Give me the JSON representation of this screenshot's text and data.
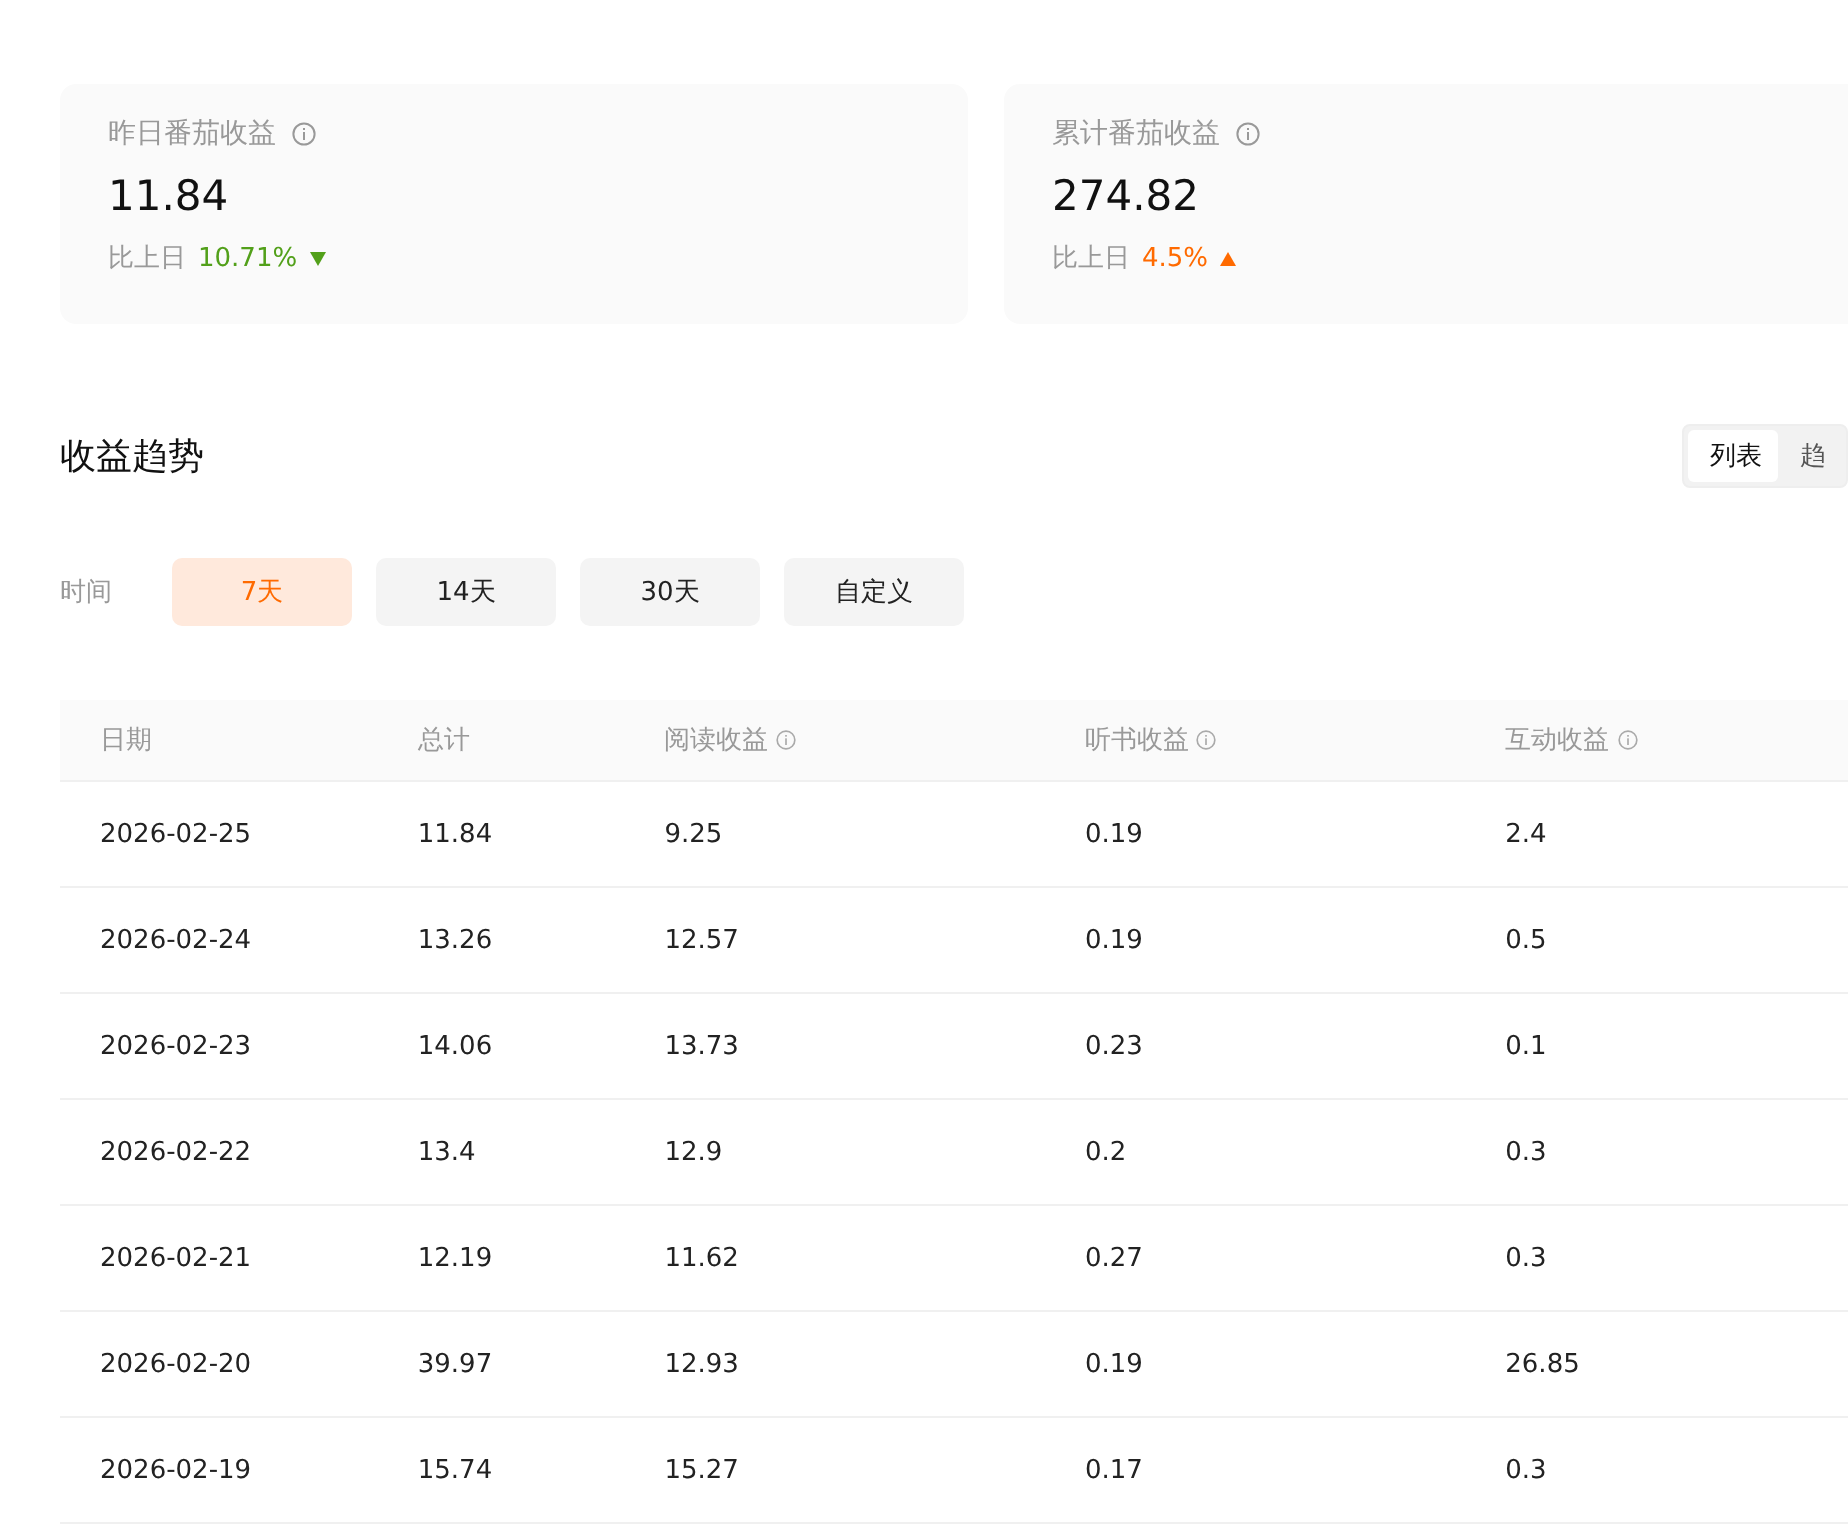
{
  "stat_cards": [
    {
      "label": "昨日番茄收益",
      "value": "11.84",
      "compare_label": "比上日",
      "change": "10.71%",
      "kind": "down"
    },
    {
      "label": "累计番茄收益",
      "value": "274.82",
      "compare_label": "比上日",
      "change": "4.5%",
      "kind": "up"
    }
  ],
  "section": {
    "title": "收益趋势",
    "view_toggle": [
      {
        "label": "列表",
        "selected": true
      },
      {
        "label": "趋",
        "selected": false
      }
    ]
  },
  "time_filter": {
    "label": "时间",
    "options": [
      {
        "label": "7天",
        "selected": true
      },
      {
        "label": "14天",
        "selected": false
      },
      {
        "label": "30天",
        "selected": false
      },
      {
        "label": "自定义",
        "selected": false
      }
    ]
  },
  "table": {
    "columns": [
      {
        "label": "日期",
        "info": false
      },
      {
        "label": "总计",
        "info": false
      },
      {
        "label": "阅读收益",
        "info": true
      },
      {
        "label": "听书收益",
        "info": true
      },
      {
        "label": "互动收益",
        "info": true
      }
    ],
    "rows": [
      [
        "2026-02-25",
        "11.84",
        "9.25",
        "0.19",
        "2.4"
      ],
      [
        "2026-02-24",
        "13.26",
        "12.57",
        "0.19",
        "0.5"
      ],
      [
        "2026-02-23",
        "14.06",
        "13.73",
        "0.23",
        "0.1"
      ],
      [
        "2026-02-22",
        "13.4",
        "12.9",
        "0.2",
        "0.3"
      ],
      [
        "2026-02-21",
        "12.19",
        "11.62",
        "0.27",
        "0.3"
      ],
      [
        "2026-02-20",
        "39.97",
        "12.93",
        "0.19",
        "26.85"
      ],
      [
        "2026-02-19",
        "15.74",
        "15.27",
        "0.17",
        "0.3"
      ]
    ]
  }
}
